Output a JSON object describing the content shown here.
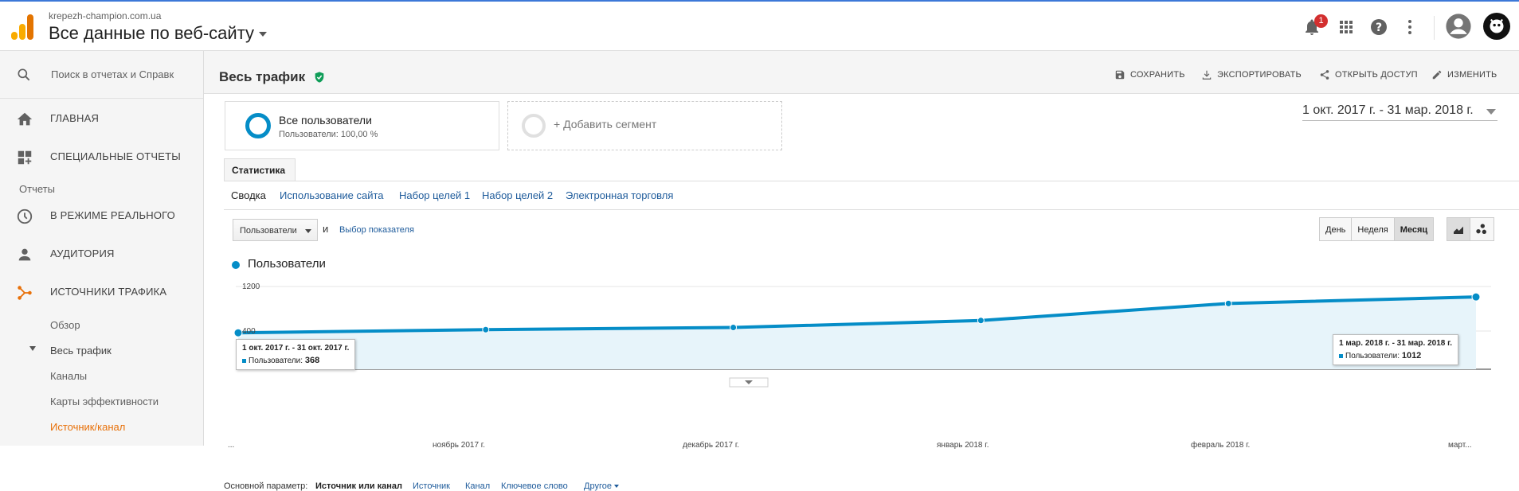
{
  "header": {
    "site": "krepezh-champion.com.ua",
    "view": "Все данные по веб-сайту",
    "notification_count": "1",
    "colors": {
      "brand_orange": "#f9ab00",
      "brand_dark_orange": "#e37400",
      "badge": "#d32f2f"
    }
  },
  "sidebar": {
    "search_placeholder": "Поиск в отчетах и Справк",
    "home": "ГЛАВНАЯ",
    "custom_reports": "СПЕЦИАЛЬНЫЕ ОТЧЕТЫ",
    "reports_label": "Отчеты",
    "realtime": "В РЕЖИМЕ РЕАЛЬНОГО",
    "audience": "АУДИТОРИЯ",
    "acquisition": "ИСТОЧНИКИ ТРАФИКА",
    "sub": {
      "overview": "Обзор",
      "all_traffic": "Весь трафик",
      "channels": "Каналы",
      "treemaps": "Карты эффективности",
      "source_medium": "Источник/канал"
    }
  },
  "page": {
    "title": "Весь трафик",
    "actions": {
      "save": "СОХРАНИТЬ",
      "export": "ЭКСПОРТИРОВАТЬ",
      "share": "ОТКРЫТЬ ДОСТУП",
      "edit": "ИЗМЕНИТЬ"
    },
    "segment": {
      "name": "Все пользователи",
      "detail": "Пользователи: 100,00 %"
    },
    "add_segment": "+ Добавить сегмент",
    "date_range": "1 окт. 2017 г. - 31 мар. 2018 г.",
    "tab": "Статистика",
    "subtabs": [
      "Сводка",
      "Использование сайта",
      "Набор целей 1",
      "Набор целей 2",
      "Электронная торговля"
    ],
    "metric_dropdown": "Пользователи",
    "and": "и",
    "select_metric": "Выбор показателя",
    "granularity": [
      "День",
      "Неделя",
      "Месяц"
    ],
    "legend": "Пользователи",
    "tooltips": {
      "first": {
        "date": "1 окт. 2017 г. - 31 окт. 2017 г.",
        "label": "Пользователи:",
        "value": "368"
      },
      "last": {
        "date": "1 мар. 2018 г. - 31 мар. 2018 г.",
        "label": "Пользователи:",
        "value": "1012"
      }
    },
    "primary_dimension": {
      "label": "Основной параметр:",
      "current": "Источник или канал",
      "options": [
        "Источник",
        "Канал",
        "Ключевое слово",
        "Другое"
      ]
    }
  },
  "chart_data": {
    "type": "area",
    "series": [
      {
        "name": "Пользователи",
        "values": [
          368,
          425,
          464,
          589,
          895,
          1012
        ]
      }
    ],
    "x_tick_labels": [
      "...",
      "ноябрь 2017 г.",
      "декабрь 2017 г.",
      "январь 2018 г.",
      "февраль 2018 г.",
      "март..."
    ],
    "y_tick_labels": [
      "1200",
      "400"
    ],
    "ylim": [
      0,
      1200
    ],
    "color": "#058dc7"
  }
}
